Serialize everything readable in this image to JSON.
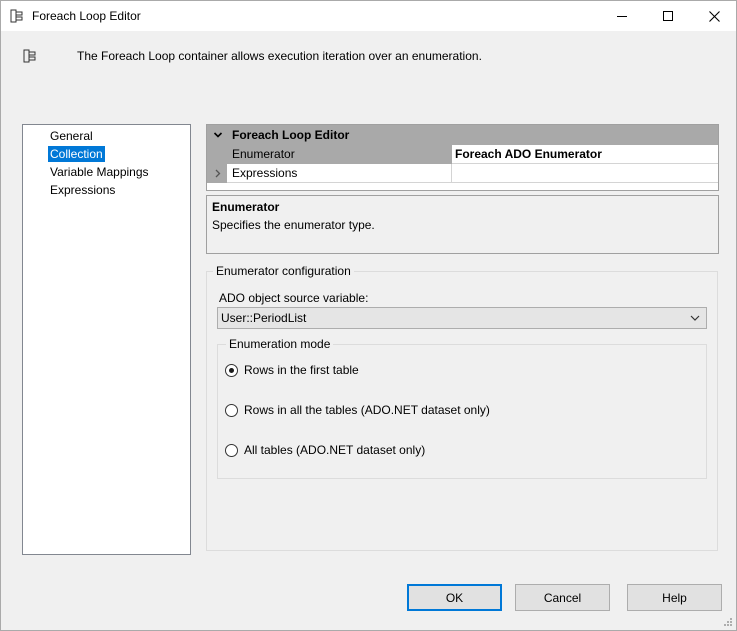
{
  "window": {
    "title": "Foreach Loop Editor"
  },
  "header": {
    "description": "The Foreach Loop container allows execution iteration over an enumeration."
  },
  "nav": {
    "items": [
      {
        "label": "General",
        "selected": false
      },
      {
        "label": "Collection",
        "selected": true
      },
      {
        "label": "Variable Mappings",
        "selected": false
      },
      {
        "label": "Expressions",
        "selected": false
      }
    ]
  },
  "property_grid": {
    "category": "Foreach Loop Editor",
    "rows": [
      {
        "name": "Enumerator",
        "value": "Foreach ADO Enumerator"
      },
      {
        "name": "Expressions",
        "value": ""
      }
    ]
  },
  "description_panel": {
    "title": "Enumerator",
    "text": "Specifies the enumerator type."
  },
  "enumerator_config": {
    "legend": "Enumerator configuration",
    "source_label": "ADO object source variable:",
    "source_value": "User::PeriodList",
    "mode_legend": "Enumeration mode",
    "modes": [
      {
        "label": "Rows in the first table",
        "checked": true
      },
      {
        "label": "Rows in all the tables (ADO.NET dataset only)",
        "checked": false
      },
      {
        "label": "All tables (ADO.NET dataset only)",
        "checked": false
      }
    ]
  },
  "buttons": {
    "ok": "OK",
    "cancel": "Cancel",
    "help": "Help"
  },
  "colors": {
    "selection": "#0078d7",
    "grid_header": "#a9a9a9"
  }
}
